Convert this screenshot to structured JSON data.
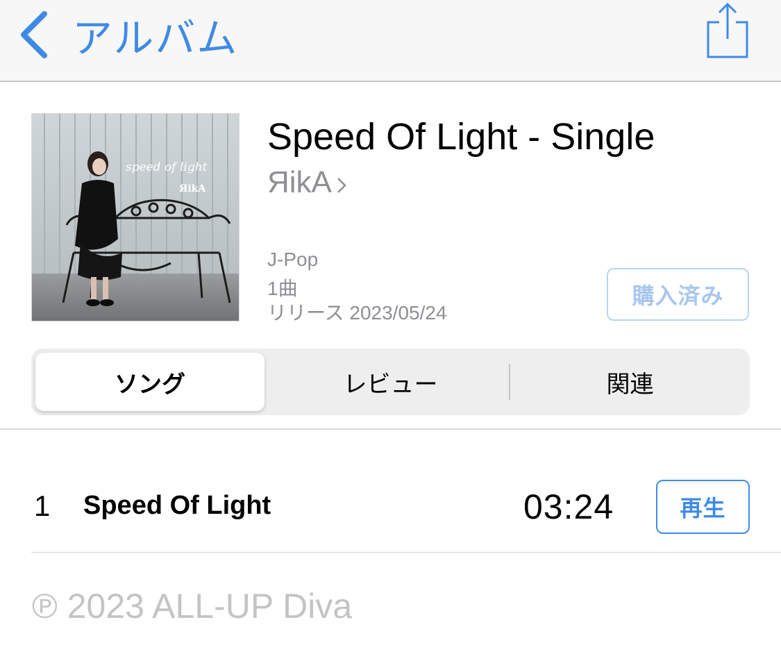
{
  "nav": {
    "back_label": "アルバム",
    "back_icon": "chevron-left-icon",
    "share_icon": "share-icon",
    "accent_color": "#3f8ae6"
  },
  "album": {
    "title": "Speed Of Light - Single",
    "artist": "ЯikA",
    "artist_chevron_icon": "chevron-right-icon",
    "genre": "J-Pop",
    "track_count": "1曲",
    "release": "リリース 2023/05/24",
    "purchased_label": "購入済み",
    "artwork": {
      "cover_text": "speed of light",
      "cover_artist": "ЯikA"
    }
  },
  "tabs": [
    {
      "label": "ソング",
      "selected": true
    },
    {
      "label": "レビュー",
      "selected": false
    },
    {
      "label": "関連",
      "selected": false
    }
  ],
  "tracks": [
    {
      "number": "1",
      "title": "Speed Of Light",
      "duration": "03:24",
      "play_label": "再生"
    }
  ],
  "footer": {
    "copyright": "℗ 2023 ALL-UP Diva"
  }
}
